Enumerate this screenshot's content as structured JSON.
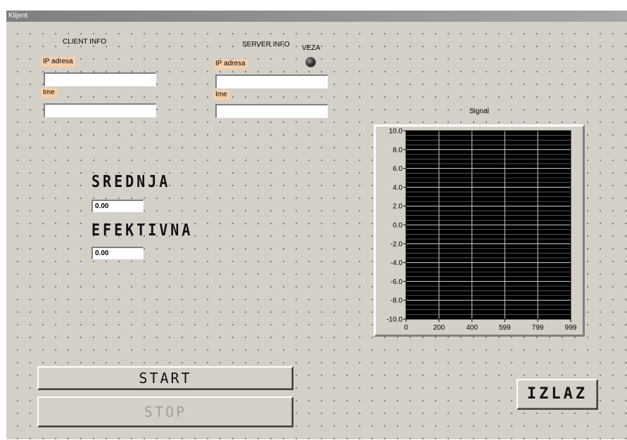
{
  "window": {
    "title": "Klijent"
  },
  "client": {
    "heading": "CLIENT INFO",
    "ip_label": "IP adresa",
    "ip_value": "",
    "name_label": "Ime",
    "name_value": ""
  },
  "server": {
    "heading": "SERVER INFO",
    "veza_label": "VEZA",
    "ip_label": "IP adresa",
    "ip_value": "",
    "name_label": "Ime",
    "name_value": ""
  },
  "measurements": {
    "srednja_label": "SREDNJA",
    "srednja_value": "0.00",
    "efektivna_label": "EFEKTIVNA",
    "efektivna_value": "0.00"
  },
  "buttons": {
    "start": "START",
    "stop": "STOP",
    "izlaz": "IZLAZ"
  },
  "colors": {
    "panel": "#d4d0c8",
    "label_tag": "#f8cfa8",
    "plot_bg": "#000000",
    "led_off": "#1a1a1a"
  },
  "chart_data": {
    "type": "line",
    "title": "Signal",
    "xlabel": "",
    "ylabel": "",
    "x_ticks": [
      "0",
      "200",
      "400",
      "599",
      "799",
      "999"
    ],
    "y_ticks": [
      "10.0",
      "8.0",
      "6.0",
      "4.0",
      "2.0",
      "0.0",
      "-2.0",
      "-4.0",
      "-6.0",
      "-8.0",
      "-10.0"
    ],
    "xlim": [
      0,
      999
    ],
    "ylim": [
      -10,
      10
    ],
    "series": [],
    "grid": true,
    "minor_grid": true
  }
}
